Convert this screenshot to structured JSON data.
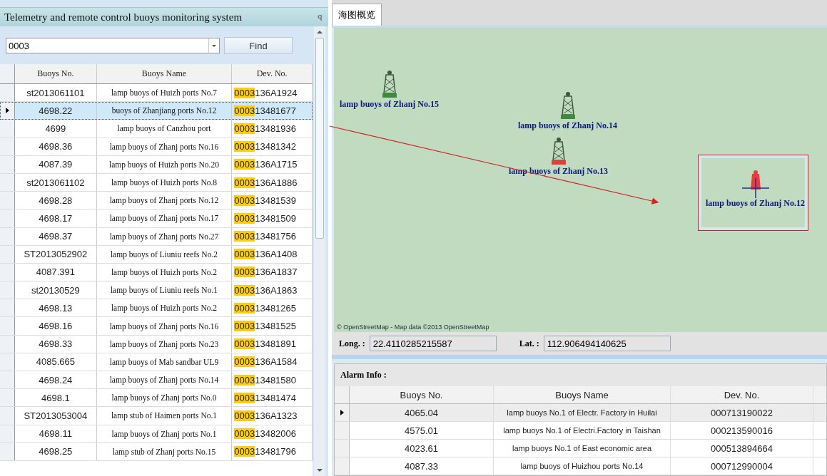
{
  "left_panel": {
    "title": "Telemetry and remote control buoys monitoring system",
    "pin": "ꟼ",
    "search": {
      "value": "0003",
      "button": "Find"
    },
    "columns": [
      "Buoys No.",
      "Buoys Name",
      "Dev. No."
    ],
    "rows": [
      {
        "buoy_no": "st2013061101",
        "name": "lamp buoys of Huizh ports No.7",
        "dev_match": "0003",
        "dev_rest": "136A1924",
        "selected": false
      },
      {
        "buoy_no": "4698.22",
        "name": "buoys of Zhanjiang ports No.12",
        "dev_match": "0003",
        "dev_rest": "13481677",
        "selected": true
      },
      {
        "buoy_no": "4699",
        "name": "lamp buoys of Canzhou port",
        "dev_match": "0003",
        "dev_rest": "13481936",
        "selected": false
      },
      {
        "buoy_no": "4698.36",
        "name": "lamp buoys of Zhanj ports No.16",
        "dev_match": "0003",
        "dev_rest": "13481342",
        "selected": false
      },
      {
        "buoy_no": "4087.39",
        "name": "lamp buoys of Huizh ports No.20",
        "dev_match": "0003",
        "dev_rest": "136A1715",
        "selected": false
      },
      {
        "buoy_no": "st2013061102",
        "name": "lamp buoys of Huizh ports No.8",
        "dev_match": "0003",
        "dev_rest": "136A1886",
        "selected": false
      },
      {
        "buoy_no": "4698.28",
        "name": "lamp buoys of Zhanj ports No.12",
        "dev_match": "0003",
        "dev_rest": "13481539",
        "selected": false
      },
      {
        "buoy_no": "4698.17",
        "name": "lamp buoys of Zhanj ports No.17",
        "dev_match": "0003",
        "dev_rest": "13481509",
        "selected": false
      },
      {
        "buoy_no": "4698.37",
        "name": "lamp buoys of Zhanj ports No.27",
        "dev_match": "0003",
        "dev_rest": "13481756",
        "selected": false
      },
      {
        "buoy_no": "ST2013052902",
        "name": "lamp buoys of Liuniu reefs No.2",
        "dev_match": "0003",
        "dev_rest": "136A1408",
        "selected": false
      },
      {
        "buoy_no": "4087.391",
        "name": "lamp buoys of Huizh ports No.2",
        "dev_match": "0003",
        "dev_rest": "136A1837",
        "selected": false
      },
      {
        "buoy_no": "st20130529",
        "name": "lamp buoys of Liuniu reefs No.1",
        "dev_match": "0003",
        "dev_rest": "136A1863",
        "selected": false
      },
      {
        "buoy_no": "4698.13",
        "name": "lamp buoys of Huizh ports No.2",
        "dev_match": "0003",
        "dev_rest": "13481265",
        "selected": false
      },
      {
        "buoy_no": "4698.16",
        "name": "lamp buoys of Zhanj ports No.16",
        "dev_match": "0003",
        "dev_rest": "13481525",
        "selected": false
      },
      {
        "buoy_no": "4698.33",
        "name": "lamp buoys of Zhanj ports No.23",
        "dev_match": "0003",
        "dev_rest": "13481891",
        "selected": false
      },
      {
        "buoy_no": "4085.665",
        "name": "lamp buoys of Mab sandbar UL9",
        "dev_match": "0003",
        "dev_rest": "136A1584",
        "selected": false
      },
      {
        "buoy_no": "4698.24",
        "name": "lamp buoys of Zhanj ports No.14",
        "dev_match": "0003",
        "dev_rest": "13481580",
        "selected": false
      },
      {
        "buoy_no": "4698.1",
        "name": "lamp buoys of Zhanj ports No.0",
        "dev_match": "0003",
        "dev_rest": "13481474",
        "selected": false
      },
      {
        "buoy_no": "ST2013053004",
        "name": "lamp stub of Haimen ports No.1",
        "dev_match": "0003",
        "dev_rest": "136A1323",
        "selected": false
      },
      {
        "buoy_no": "4698.11",
        "name": "lamp buoys of Zhanj ports No.1",
        "dev_match": "0003",
        "dev_rest": "13482006",
        "selected": false
      },
      {
        "buoy_no": "4698.25",
        "name": "lamp stub of Zhanj ports No.15",
        "dev_match": "0003",
        "dev_rest": "13481796",
        "selected": false
      }
    ]
  },
  "map": {
    "tab": {
      "label": "海图概览",
      "selected": true
    },
    "markers": [
      {
        "label": "lamp buoys of Zhanj No.15",
        "color": "#3c8c3c",
        "selected": false
      },
      {
        "label": "lamp buoys of Zhanj No.14",
        "color": "#3c8c3c",
        "selected": false
      },
      {
        "label": "lamp buoys of Zhanj No.13",
        "color": "#e83c3c",
        "selected": false
      },
      {
        "label": "lamp buoys of Zhanj No.12",
        "color": "#e83c3c",
        "selected": true
      }
    ],
    "attribution": "© OpenStreetMap - Map data ©2013 OpenStreetMap"
  },
  "coordinates": {
    "long_label": "Long. :",
    "long_value": "22.4110285215587",
    "lat_label": "Lat. :",
    "lat_value": "112.906494140625"
  },
  "alarm": {
    "title": "Alarm Info :",
    "columns": [
      "Buoys No.",
      "Buoys Name",
      "Dev. No."
    ],
    "rows": [
      {
        "buoy_no": "4065.04",
        "name": "lamp buoys No.1 of Electr. Factory in Huilai",
        "dev_no": "000713190022",
        "selected": true
      },
      {
        "buoy_no": "4575.01",
        "name": "lamp buoys No.1 of Electri.Factory in Taishan",
        "dev_no": "000213590016",
        "selected": false
      },
      {
        "buoy_no": "4023.61",
        "name": "lamp buoys No.1 of East economic area",
        "dev_no": "000513894664",
        "selected": false
      },
      {
        "buoy_no": "4087.33",
        "name": "lamp buoys of Huizhou ports No.14",
        "dev_no": "000712990004",
        "selected": false
      }
    ]
  }
}
